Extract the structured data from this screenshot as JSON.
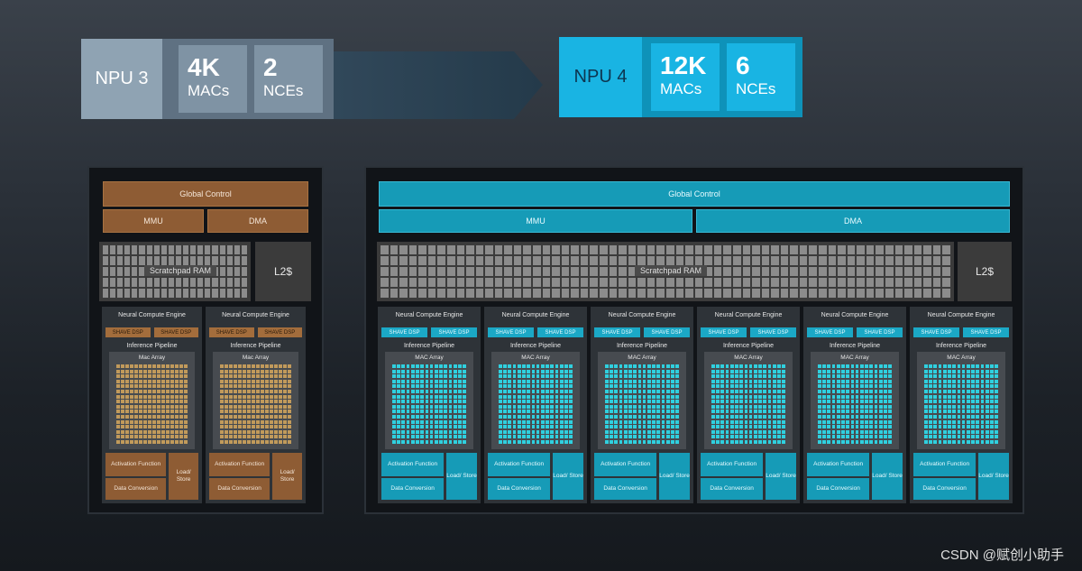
{
  "header": {
    "left": {
      "gen": "NPU 3",
      "macs_value": "4K",
      "macs_unit": "MACs",
      "nces_value": "2",
      "nces_unit": "NCEs"
    },
    "right": {
      "gen": "NPU 4",
      "macs_value": "12K",
      "macs_unit": "MACs",
      "nces_value": "6",
      "nces_unit": "NCEs"
    }
  },
  "npu3": {
    "global_control": "Global Control",
    "mmu": "MMU",
    "dma": "DMA",
    "scratchpad": "Scratchpad RAM",
    "l2": "L2$",
    "nce_title": "Neural Compute Engine",
    "shave_dsp": "SHAVE DSP",
    "inference_pipeline": "Inference Pipeline",
    "mac_array": "Mac Array",
    "activation": "Activation Function",
    "load_store": "Load/ Store",
    "data_conversion": "Data Conversion",
    "nce_count": 2
  },
  "npu4": {
    "global_control": "Global Control",
    "mmu": "MMU",
    "dma": "DMA",
    "scratchpad": "Scratchpad RAM",
    "l2": "L2$",
    "nce_title": "Neural Compute Engine",
    "shave_dsp": "SHAVE DSP",
    "inference_pipeline": "Inference Pipeline",
    "mac_array": "MAC Array",
    "activation": "Activation Function",
    "load_store": "Load/ Store",
    "data_conversion": "Data Conversion",
    "nce_count": 6
  },
  "colors": {
    "npu3_accent": "#a36d3c",
    "npu3_bar": "#8e5c34",
    "npu3_cell": "#c19a5b",
    "npu4_accent": "#1ba8c6",
    "npu4_bar": "#169bb7",
    "npu4_cell": "#2fd0df"
  },
  "watermark": "CSDN @赋创小助手"
}
